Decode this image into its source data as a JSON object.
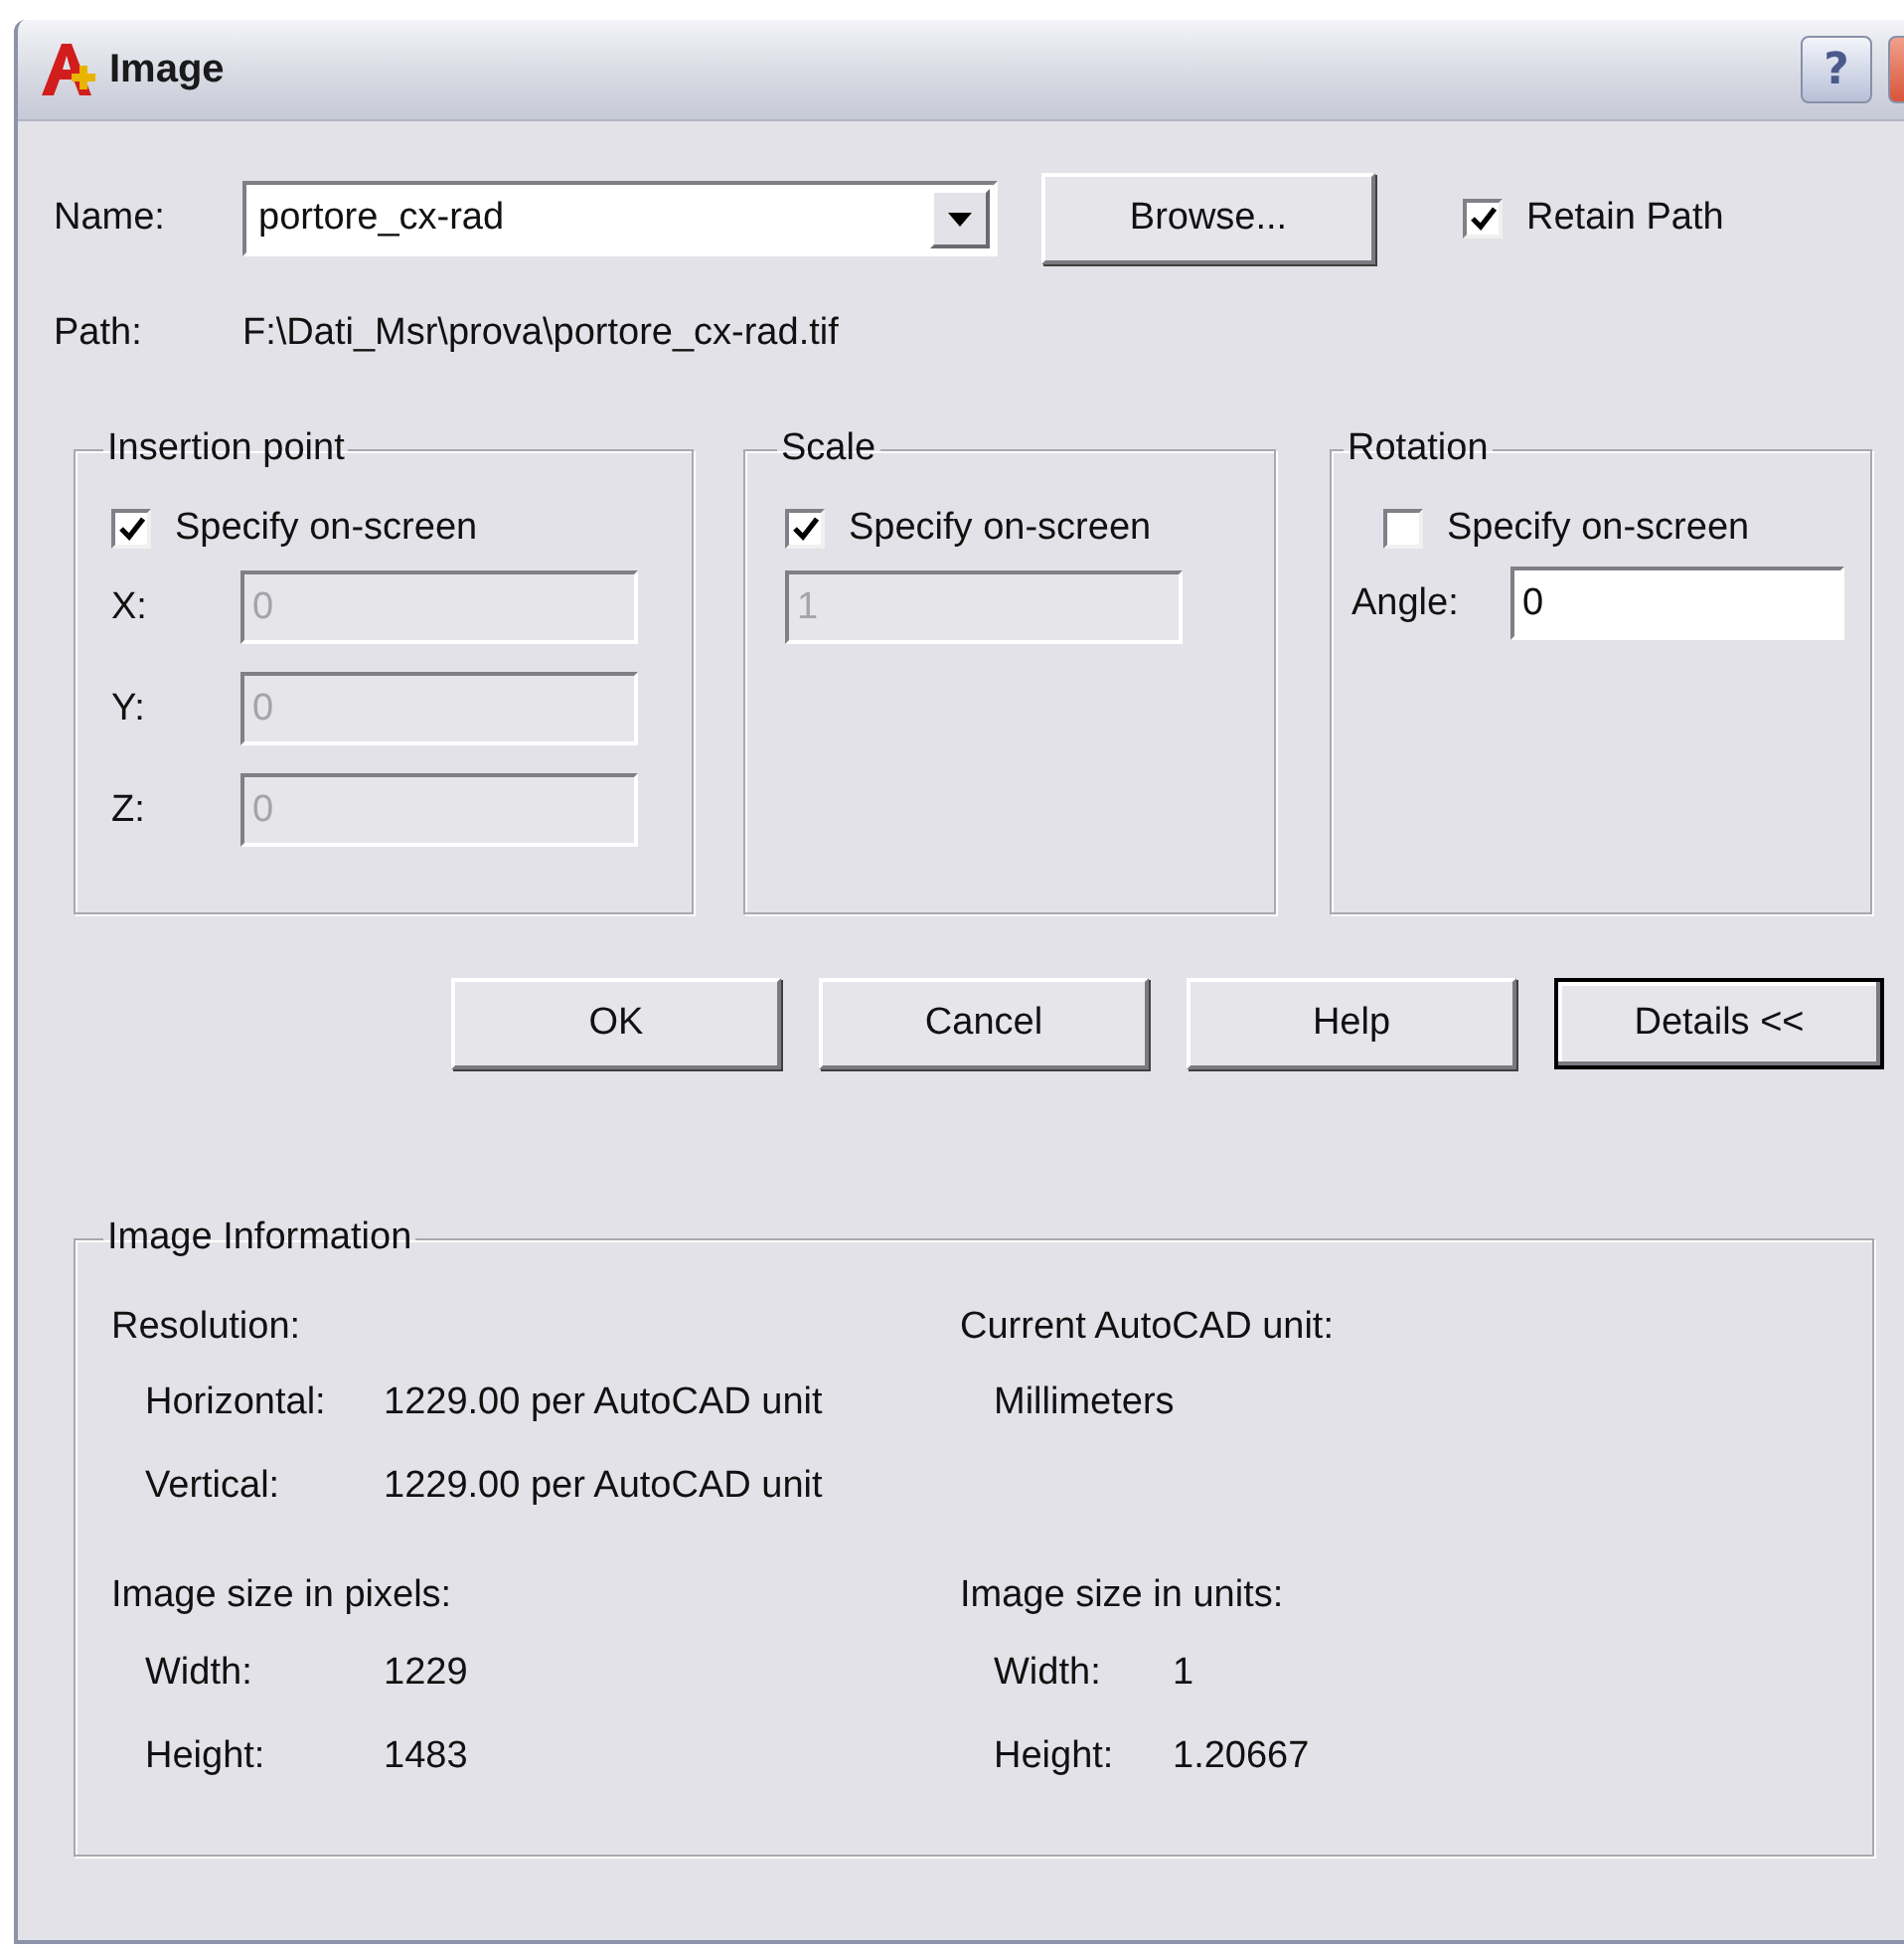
{
  "window": {
    "title": "Image",
    "help_glyph": "?"
  },
  "name": {
    "label": "Name:",
    "value": "portore_cx-rad"
  },
  "browse_button": {
    "label": "Browse..."
  },
  "retain_path": {
    "label": "Retain Path",
    "checked": true
  },
  "path": {
    "label": "Path:",
    "value": "F:\\Dati_Msr\\prova\\portore_cx-rad.tif"
  },
  "insertion_point": {
    "title": "Insertion point",
    "specify_on_screen": {
      "label": "Specify on-screen",
      "checked": true
    },
    "fields": [
      {
        "label": "X:",
        "value": "0",
        "disabled": true
      },
      {
        "label": "Y:",
        "value": "0",
        "disabled": true
      },
      {
        "label": "Z:",
        "value": "0",
        "disabled": true
      }
    ]
  },
  "scale": {
    "title": "Scale",
    "specify_on_screen": {
      "label": "Specify on-screen",
      "checked": true
    },
    "field": {
      "value": "1",
      "disabled": true
    }
  },
  "rotation": {
    "title": "Rotation",
    "specify_on_screen": {
      "label": "Specify on-screen",
      "checked": false
    },
    "angle": {
      "label": "Angle:",
      "value": "0",
      "disabled": false
    }
  },
  "buttons": [
    {
      "label": "OK",
      "focused": false
    },
    {
      "label": "Cancel",
      "focused": false
    },
    {
      "label": "Help",
      "focused": false
    },
    {
      "label": "Details <<",
      "focused": true
    }
  ],
  "image_information": {
    "title": "Image Information",
    "resolution": {
      "label": "Resolution:",
      "rows": [
        {
          "label": "Horizontal:",
          "value": "1229.00 per AutoCAD unit"
        },
        {
          "label": "Vertical:",
          "value": "1229.00 per AutoCAD unit"
        }
      ]
    },
    "current_unit": {
      "label": "Current AutoCAD unit:",
      "value": "Millimeters"
    },
    "size_in_pixels": {
      "label": "Image size in pixels:",
      "rows": [
        {
          "label": "Width:",
          "value": "1229"
        },
        {
          "label": "Height:",
          "value": "1483"
        }
      ]
    },
    "size_in_units": {
      "label": "Image size in units:",
      "rows": [
        {
          "label": "Width:",
          "value": "1"
        },
        {
          "label": "Height:",
          "value": "1.20667"
        }
      ]
    }
  }
}
